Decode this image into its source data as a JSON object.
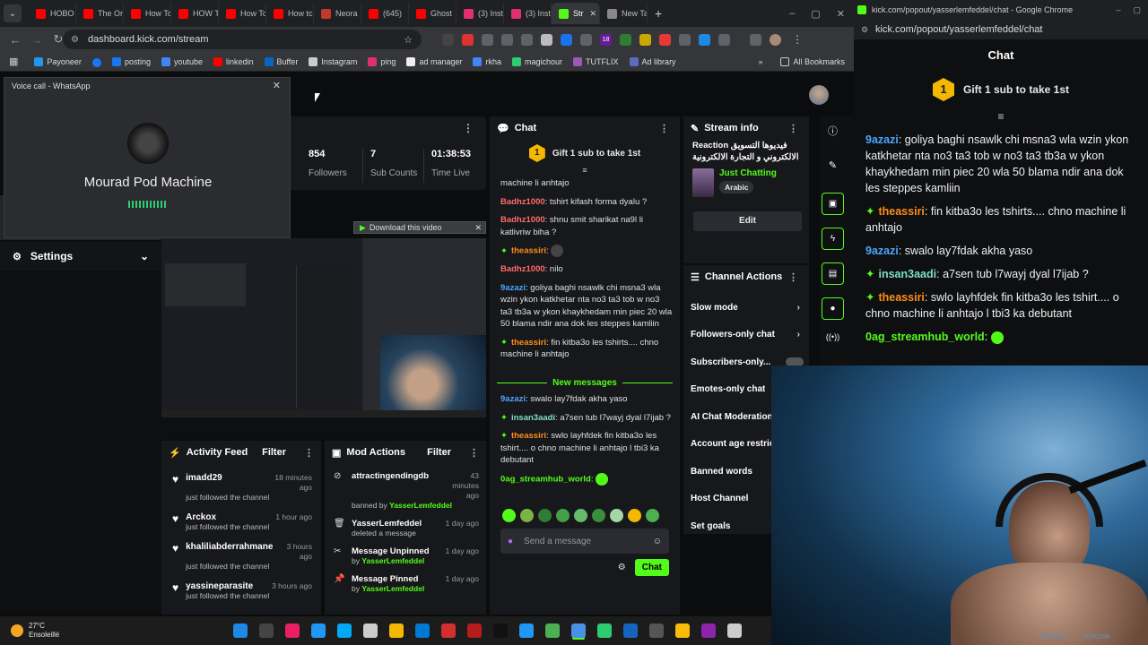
{
  "browser": {
    "tabs": [
      {
        "label": "HOBO",
        "color": "#ff0000"
      },
      {
        "label": "The Or",
        "color": "#ff0000"
      },
      {
        "label": "How Tc",
        "color": "#ff0000"
      },
      {
        "label": "HOW T",
        "color": "#ff0000"
      },
      {
        "label": "How Tc",
        "color": "#ff0000"
      },
      {
        "label": "How tc",
        "color": "#ff0000"
      },
      {
        "label": "Neora",
        "color": "#c0392b"
      },
      {
        "label": "(645)",
        "color": "#ff0000"
      },
      {
        "label": "Ghost",
        "color": "#ff0000"
      },
      {
        "label": "(3) Inst",
        "color": "#e1306c"
      },
      {
        "label": "(3) Inst",
        "color": "#e1306c"
      },
      {
        "label": "Str",
        "color": "#53fc18"
      },
      {
        "label": "New Ta",
        "color": "#888888"
      }
    ],
    "url": "dashboard.kick.com/stream",
    "bookmarks": [
      "Payoneer",
      "posting",
      "youtube",
      "linkedin",
      "Buffer",
      "Instagram",
      "ping",
      "ad manager",
      "rkha",
      "magichour",
      "TUTFLIX",
      "Ad library"
    ],
    "all_bookmarks": "All Bookmarks",
    "ext_badge": "18"
  },
  "popout_window": {
    "title": "kick.com/popout/yasserlemfeddel/chat - Google Chrome",
    "url": "kick.com/popout/yasserlemfeddel/chat"
  },
  "whatsapp": {
    "title": "Voice call - WhatsApp",
    "caller": "Mourad Pod Machine"
  },
  "stats": [
    {
      "value": "854",
      "label": "Followers"
    },
    {
      "value": "7",
      "label": "Sub Counts"
    },
    {
      "value": "01:38:53",
      "label": "Time Live"
    }
  ],
  "settings_label": "Settings",
  "download_label": "Download this video",
  "chat": {
    "title": "Chat",
    "gift": "Gift 1 sub to take 1st",
    "messages": [
      {
        "user": "",
        "color": "#e0e0e0",
        "text": "machine li anhtajo"
      },
      {
        "user": "Badhz1000",
        "color": "#ff6b6b",
        "text": "tshirt kifash forma dyalu ?"
      },
      {
        "user": "Badhz1000",
        "color": "#ff6b6b",
        "text": "shnu smit sharikat na9l li katlivriw biha ?"
      },
      {
        "user": "theassiri",
        "color": "#ff8c1a",
        "text": ""
      },
      {
        "user": "Badhz1000",
        "color": "#ff6b6b",
        "text": "nilo"
      },
      {
        "user": "9azazi",
        "color": "#4da6ff",
        "text": "goliya baghi nsawlk chi msna3 wla wzin ykon katkhetar nta no3 ta3 tob w no3 ta3 tb3a w ykon khaykhedam min piec 20 wla 50 blama ndir ana dok les steppes kamliin"
      },
      {
        "user": "theassiri",
        "color": "#ff8c1a",
        "text": "fin kitba3o les tshirts.... chno machine li anhtajo"
      }
    ],
    "new_messages": "New messages",
    "messages2": [
      {
        "user": "9azazi",
        "color": "#4da6ff",
        "text": "swalo lay7fdak akha yaso"
      },
      {
        "user": "insan3aadi",
        "color": "#7fe0c0",
        "text": "a7sen tub l7wayj dyal l7ijab ?"
      },
      {
        "user": "theassiri",
        "color": "#ff8c1a",
        "text": "swlo layhfdek fin kitba3o les tshirt.... o chno machine li anhtajo l tbi3 ka debutant"
      },
      {
        "user": "0ag_streamhub_world",
        "color": "#53fc18",
        "text": ""
      }
    ],
    "placeholder": "Send a message",
    "send_label": "Chat"
  },
  "stream_info": {
    "title": "Stream info",
    "stream_title": "Reaction فيديوها التسويق الالكتروني و التجارة الالكترونية",
    "category": "Just Chatting",
    "language": "Arabic",
    "edit": "Edit"
  },
  "channel_actions": {
    "title": "Channel Actions",
    "items": [
      "Slow mode",
      "Followers-only chat",
      "Subscribers-only...",
      "Emotes-only chat",
      "AI Chat Moderation",
      "Account age restric",
      "Banned words",
      "Host Channel",
      "Set goals"
    ]
  },
  "activity_feed": {
    "title": "Activity Feed",
    "filter": "Filter",
    "items": [
      {
        "name": "imadd29",
        "action": "just followed the channel",
        "time": "18 minutes ago"
      },
      {
        "name": "Arckox",
        "action": "just followed the channel",
        "time": "1 hour ago"
      },
      {
        "name": "khaliliabderrahmane",
        "action": "just followed the channel",
        "time": "3 hours ago"
      },
      {
        "name": "yassineparasite",
        "action": "just followed the channel",
        "time": "3 hours ago"
      }
    ]
  },
  "mod_actions": {
    "title": "Mod Actions",
    "filter": "Filter",
    "items": [
      {
        "name": "attractingendingdb",
        "action": "banned by",
        "by": "YasserLemfeddel",
        "time": "43 minutes ago"
      },
      {
        "name": "YasserLemfeddel",
        "action": "deleted a message",
        "by": "",
        "time": "1 day ago"
      },
      {
        "name": "Message Unpinned",
        "action": "by",
        "by": "YasserLemfeddel",
        "time": "1 day ago"
      },
      {
        "name": "Message Pinned",
        "action": "by",
        "by": "YasserLemfeddel",
        "time": "1 day ago"
      }
    ]
  },
  "popout_chat": {
    "title": "Chat",
    "gift": "Gift 1 sub to take 1st",
    "messages": [
      {
        "user": "9azazi",
        "color": "#4da6ff",
        "text": "goliya baghi nsawlk chi msna3 wla wzin ykon katkhetar nta no3 ta3 tob w no3 ta3 tb3a w ykon khaykhedam min piec 20 wla 50 blama ndir ana dok les steppes kamliin"
      },
      {
        "user": "theassiri",
        "color": "#ff8c1a",
        "text": "fin kitba3o les tshirts.... chno machine li anhtajo"
      },
      {
        "user": "9azazi",
        "color": "#4da6ff",
        "text": "swalo lay7fdak akha yaso"
      },
      {
        "user": "insan3aadi",
        "color": "#7fe0c0",
        "text": "a7sen tub l7wayj dyal l7ijab ?"
      },
      {
        "user": "theassiri",
        "color": "#ff8c1a",
        "text": "swlo layhfdek fin kitba3o les tshirt.... o chno machine li anhtajo l tbi3 ka debutant"
      },
      {
        "user": "0ag_streamhub_world",
        "color": "#53fc18",
        "text": ""
      }
    ]
  },
  "webcam_overlay_text": [
    "TRAFFIC",
    "DOTCOM"
  ],
  "taskbar": {
    "weather_temp": "27°C",
    "weather_desc": "Ensoleillé"
  },
  "colors": {
    "kick_green": "#53fc18",
    "panel": "#17181b",
    "bg": "#0b0c0e"
  }
}
